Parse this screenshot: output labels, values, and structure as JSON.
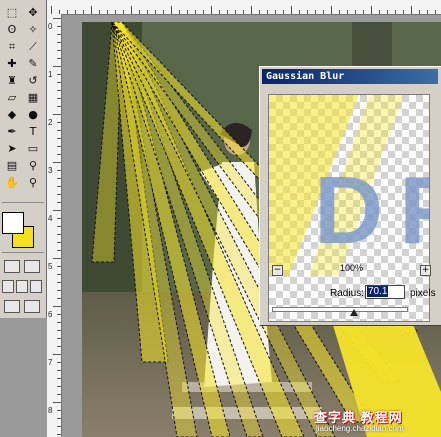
{
  "toolbox": {
    "tools": [
      {
        "name": "marquee-tool-icon",
        "glyph": "⬚"
      },
      {
        "name": "move-tool-icon",
        "glyph": "✥"
      },
      {
        "name": "lasso-tool-icon",
        "glyph": "ʘ"
      },
      {
        "name": "magic-wand-tool-icon",
        "glyph": "✧"
      },
      {
        "name": "crop-tool-icon",
        "glyph": "⌗"
      },
      {
        "name": "slice-tool-icon",
        "glyph": "⟋"
      },
      {
        "name": "healing-brush-tool-icon",
        "glyph": "✚"
      },
      {
        "name": "brush-tool-icon",
        "glyph": "✎"
      },
      {
        "name": "clone-stamp-tool-icon",
        "glyph": "♜"
      },
      {
        "name": "history-brush-tool-icon",
        "glyph": "↺"
      },
      {
        "name": "eraser-tool-icon",
        "glyph": "▱"
      },
      {
        "name": "gradient-tool-icon",
        "glyph": "▦"
      },
      {
        "name": "blur-tool-icon",
        "glyph": "◆"
      },
      {
        "name": "dodge-tool-icon",
        "glyph": "●"
      },
      {
        "name": "pen-tool-icon",
        "glyph": "✒"
      },
      {
        "name": "type-tool-icon",
        "glyph": "T"
      },
      {
        "name": "path-selection-tool-icon",
        "glyph": "➤"
      },
      {
        "name": "shape-tool-icon",
        "glyph": "▭"
      },
      {
        "name": "notes-tool-icon",
        "glyph": "▤"
      },
      {
        "name": "eyedropper-tool-icon",
        "glyph": "⚲"
      },
      {
        "name": "hand-tool-icon",
        "glyph": "✋"
      },
      {
        "name": "zoom-tool-icon",
        "glyph": "⚲"
      }
    ],
    "foreground_color": "#ffffff",
    "background_color": "#f2e21c"
  },
  "rulers": {
    "left_labels": [
      "0",
      "1",
      "2",
      "3",
      "4",
      "5",
      "6",
      "7",
      "8"
    ]
  },
  "dialog": {
    "title": "Gaussian Blur",
    "zoom_minus": "−",
    "zoom_plus": "+",
    "zoom_level": "100%",
    "radius_label": "Radius:",
    "radius_value": "70.1",
    "radius_units": "pixels",
    "slider_level": 0.6
  },
  "watermark": {
    "main": "查字典 教程网",
    "url": "jiaocheng.chazidian.com"
  },
  "colors": {
    "selection_fill": "#f5e42a",
    "title_bar": "#0a246a",
    "preview_text": "#7f9bc9"
  }
}
